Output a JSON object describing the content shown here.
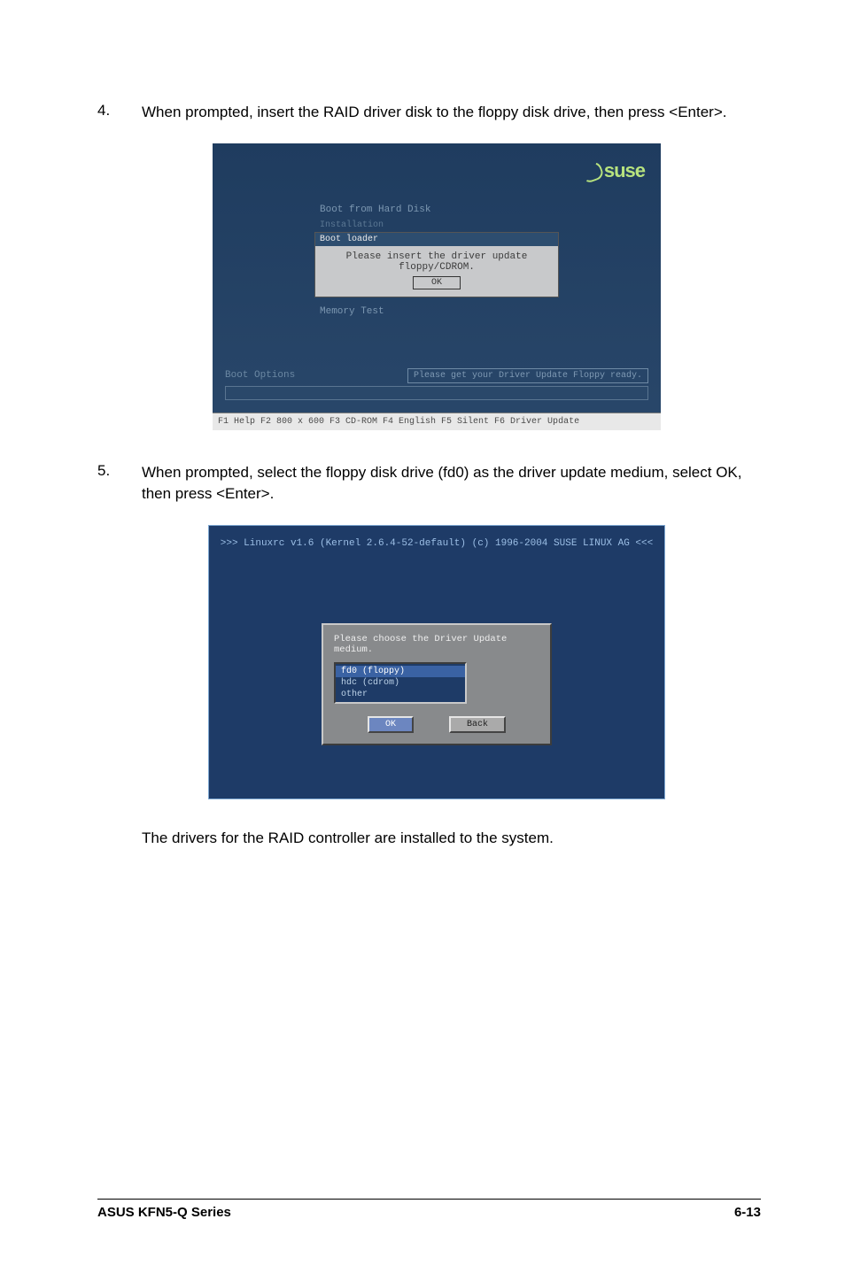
{
  "steps": {
    "s4_num": "4.",
    "s4_text": "When prompted, insert the RAID driver disk to the floppy disk drive, then press <Enter>.",
    "s5_num": "5.",
    "s5_text": "When prompted, select the floppy disk drive (fd0) as the driver update medium, select OK, then press <Enter>."
  },
  "screenshot1": {
    "logo": "suse",
    "menu_boot_from_hd": "Boot from Hard Disk",
    "menu_installation": "Installation",
    "dialog_title": "Boot loader",
    "dialog_msg": "Please insert the driver update floppy/CDROM.",
    "dialog_ok": "OK",
    "menu_memory_test": "Memory Test",
    "ready_box": "Please get your Driver Update Floppy ready.",
    "boot_options_label": "Boot Options",
    "help_bar": "F1 Help  F2 800 x 600  F3 CD-ROM  F4 English  F5 Silent  F6 Driver Update"
  },
  "screenshot2": {
    "header": ">>> Linuxrc v1.6 (Kernel 2.6.4-52-default) (c) 1996-2004 SUSE LINUX AG <<<",
    "prompt": "Please choose the Driver Update medium.",
    "items": {
      "fd0": "fd0 (floppy)",
      "hdc": "hdc (cdrom)",
      "other": "other"
    },
    "ok": "OK",
    "back": "Back"
  },
  "final_text": "The drivers for the RAID controller are installed to the system.",
  "footer": {
    "left": "ASUS KFN5-Q Series",
    "right": "6-13"
  }
}
